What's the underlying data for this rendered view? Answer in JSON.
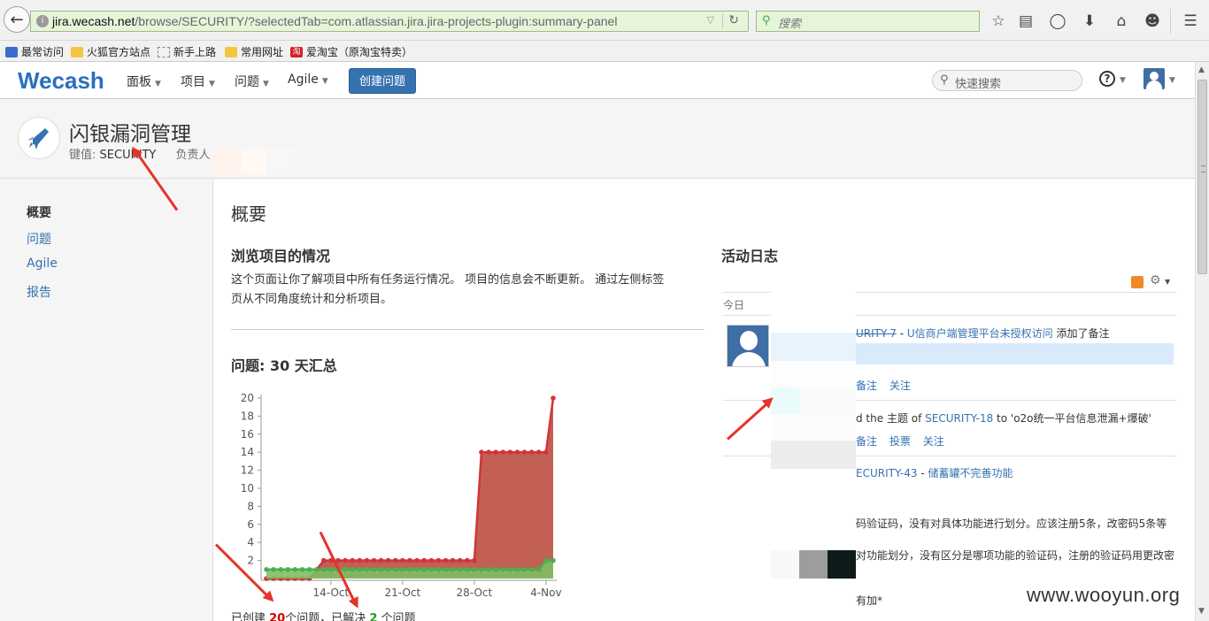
{
  "browser": {
    "url_host": "jira.wecash.net",
    "url_path": "/browse/SECURITY/?selectedTab=com.atlassian.jira.jira-projects-plugin:summary-panel",
    "search_placeholder": "搜索",
    "bookmarks": [
      "最常访问",
      "火狐官方站点",
      "新手上路",
      "常用网址",
      "爱淘宝（原淘宝特卖）"
    ],
    "bookmark_taobao_icon": "淘"
  },
  "jira": {
    "logo": "Wecash",
    "menus": [
      "面板",
      "项目",
      "问题",
      "Agile"
    ],
    "create_label": "创建问题",
    "quick_search_placeholder": "快速搜索",
    "help_glyph": "?"
  },
  "project": {
    "title": "闪银漏洞管理",
    "key_label": "键值:",
    "key_value": "SECURITY",
    "lead_label": "负责人"
  },
  "sidebar": {
    "items": [
      "概要",
      "问题",
      "Agile",
      "报告"
    ]
  },
  "main": {
    "title": "概要",
    "overview_heading": "浏览项目的情况",
    "overview_desc_1": "这个页面让你了解项目中所有任务运行情况。 项目的信息会不断更新。 通过左侧标签",
    "overview_desc_2": "页从不同角度统计和分析项目。",
    "issues_heading": "问题: 30 天汇总",
    "summary_prefix": "已创建 ",
    "summary_created": "20",
    "summary_mid": "个问题，已解决 ",
    "summary_resolved": "2",
    "summary_suffix": " 个问题"
  },
  "activity": {
    "title": "活动日志",
    "day": "今日",
    "items": [
      {
        "issue": "URITY-7",
        "sep": " - ",
        "link": "U信商户端管理平台未授权访问",
        "suffix": " 添加了备注",
        "actions": [
          "备注",
          "关注"
        ]
      },
      {
        "prefix": "d the 主题 of ",
        "issue": "SECURITY-18",
        "suffix": " to 'o2o统一平台信息泄漏+爆破'",
        "actions": [
          "备注",
          "投票",
          "关注"
        ]
      },
      {
        "issue": "ECURITY-43",
        "sep": " - ",
        "link": "储蓄罐不完善功能"
      }
    ],
    "text_lines": [
      "码验证码，没有对具体功能进行划分。应该注册5条，改密码5条等",
      "对功能划分，没有区分是哪项功能的验证码，注册的验证码用更改密",
      "有加*"
    ]
  },
  "watermark": "www.wooyun.org",
  "chart_data": {
    "type": "area",
    "x": [
      1,
      2,
      3,
      4,
      5,
      6,
      7,
      8,
      9,
      10,
      11,
      12,
      13,
      14,
      15,
      16,
      17,
      18,
      19,
      20,
      21,
      22,
      23,
      24,
      25,
      26,
      27,
      28,
      29,
      30,
      31,
      32,
      33,
      34,
      35,
      36,
      37,
      38,
      39,
      40,
      41,
      42
    ],
    "x_ticks": [
      {
        "x": 10,
        "label": "14-Oct"
      },
      {
        "x": 20,
        "label": "21-Oct"
      },
      {
        "x": 30,
        "label": "28-Oct"
      },
      {
        "x": 40,
        "label": "4-Nov"
      }
    ],
    "ylim": [
      0,
      20
    ],
    "yticks": [
      2,
      4,
      6,
      8,
      10,
      12,
      14,
      16,
      18,
      20
    ],
    "series": [
      {
        "name": "",
        "color": "#d0353b",
        "fill": "#c0574b",
        "values": [
          0,
          0,
          0,
          0,
          0,
          0,
          0,
          1,
          2,
          2,
          2,
          2,
          2,
          2,
          2,
          2,
          2,
          2,
          2,
          2,
          2,
          2,
          2,
          2,
          2,
          2,
          2,
          2,
          2,
          2,
          14,
          14,
          14,
          14,
          14,
          14,
          14,
          14,
          14,
          14,
          20
        ]
      },
      {
        "name": "",
        "color": "#4caf50",
        "fill": "#7fbf60",
        "values": [
          1,
          1,
          1,
          1,
          1,
          1,
          1,
          1,
          1,
          1,
          1,
          1,
          1,
          1,
          1,
          1,
          1,
          1,
          1,
          1,
          1,
          1,
          1,
          1,
          1,
          1,
          1,
          1,
          1,
          1,
          1,
          1,
          1,
          1,
          1,
          1,
          1,
          1,
          1,
          2,
          2
        ]
      }
    ],
    "grid": false
  }
}
